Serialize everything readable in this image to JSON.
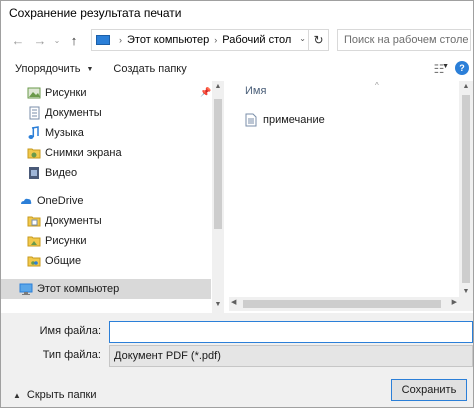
{
  "window": {
    "title": "Сохранение результата печати"
  },
  "nav": {
    "back_icon": "arrow-left-icon",
    "forward_icon": "arrow-right-icon",
    "recent_icon": "chevron-down-icon",
    "up_icon": "arrow-up-icon"
  },
  "address": {
    "segments": [
      "Этот компьютер",
      "Рабочий стол"
    ],
    "refresh_icon": "refresh-icon"
  },
  "search": {
    "placeholder": "Поиск на рабочем столе"
  },
  "toolbar": {
    "organize_label": "Упорядочить",
    "new_folder_label": "Создать папку",
    "view_icon": "view-options-icon",
    "help_icon": "help-icon"
  },
  "sidebar": {
    "items": [
      {
        "label": "Рисунки",
        "icon": "pictures-icon"
      },
      {
        "label": "Документы",
        "icon": "documents-icon"
      },
      {
        "label": "Музыка",
        "icon": "music-icon"
      },
      {
        "label": "Снимки экрана",
        "icon": "folder-icon"
      },
      {
        "label": "Видео",
        "icon": "video-icon"
      },
      {
        "label": "OneDrive",
        "icon": "onedrive-icon"
      },
      {
        "label": "Документы",
        "icon": "documents-icon"
      },
      {
        "label": "Рисунки",
        "icon": "pictures-icon"
      },
      {
        "label": "Общие",
        "icon": "shared-folder-icon"
      },
      {
        "label": "Этот компьютер",
        "icon": "computer-icon"
      }
    ]
  },
  "filelist": {
    "column_name": "Имя",
    "files": [
      {
        "name": "примечание",
        "icon": "text-file-icon"
      }
    ]
  },
  "form": {
    "filename_label": "Имя файла:",
    "filename_value": "",
    "filetype_label": "Тип файла:",
    "filetype_value": "Документ PDF (*.pdf)"
  },
  "footer": {
    "hide_folders_label": "Скрыть папки",
    "save_label": "Сохранить"
  },
  "colors": {
    "accent": "#2b7fd8",
    "selected_bg": "#d9d9d9",
    "form_bg": "#f0f0f0"
  }
}
